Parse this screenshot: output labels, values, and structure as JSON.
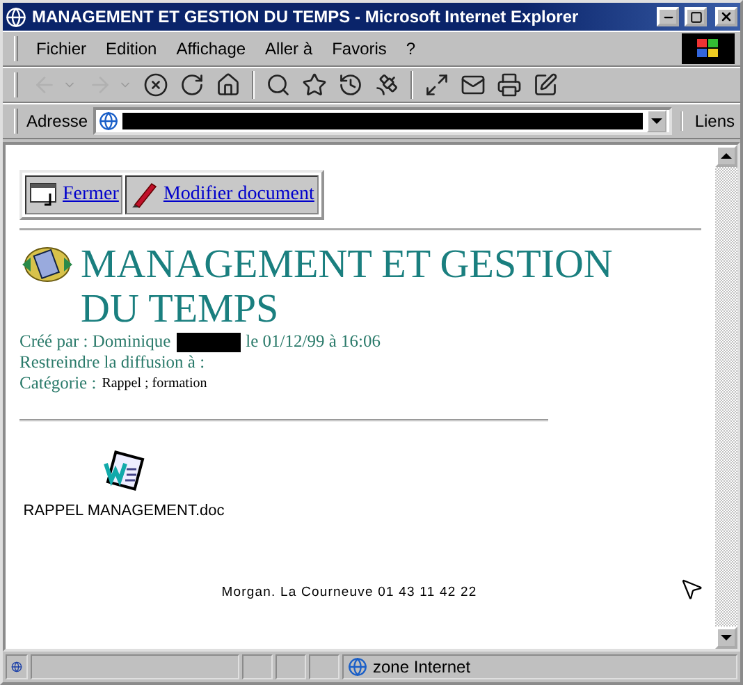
{
  "window": {
    "title": "MANAGEMENT ET GESTION DU TEMPS - Microsoft Internet Explorer"
  },
  "menu": [
    "Fichier",
    "Edition",
    "Affichage",
    "Aller à",
    "Favoris",
    "?"
  ],
  "toolbar": [
    {
      "kind": "back",
      "disabled": true
    },
    {
      "kind": "forward",
      "disabled": true
    },
    {
      "kind": "stop"
    },
    {
      "kind": "refresh"
    },
    {
      "kind": "home"
    },
    {
      "kind": "sep"
    },
    {
      "kind": "search"
    },
    {
      "kind": "favorites"
    },
    {
      "kind": "history"
    },
    {
      "kind": "channels"
    },
    {
      "kind": "sep"
    },
    {
      "kind": "fullscreen"
    },
    {
      "kind": "mail"
    },
    {
      "kind": "print"
    },
    {
      "kind": "edit"
    }
  ],
  "address": {
    "label": "Adresse",
    "links": "Liens"
  },
  "actions": [
    {
      "kind": "close",
      "label": "Fermer"
    },
    {
      "kind": "edit",
      "label": "Modifier document"
    }
  ],
  "heading": "MANAGEMENT ET GESTION DU TEMPS",
  "meta": [
    {
      "label": "Créé par : Dominique",
      "redacted": true,
      "after": "le 01/12/99 à 16:06"
    },
    {
      "label": "Restreindre la diffusion à :"
    },
    {
      "label": "Catégorie :",
      "value": "Rappel ; formation"
    }
  ],
  "attachment": {
    "name": "RAPPEL MANAGEMENT.doc"
  },
  "footer": "Morgan. La Courneuve 01 43 11 42 22",
  "status": {
    "zone": "zone Internet"
  }
}
